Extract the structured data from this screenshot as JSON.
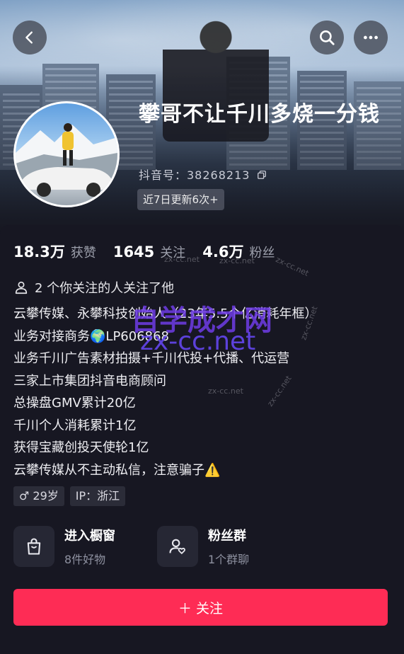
{
  "header": {
    "back_icon": "chevron-left-icon",
    "search_icon": "search-icon",
    "more_icon": "more-horizontal-icon"
  },
  "profile": {
    "name": "攀哥不让千川多烧一分钱",
    "douyin_id": "抖音号：38268213",
    "copy_icon": "copy-icon",
    "update_chip": "近7日更新6次+"
  },
  "stats": [
    {
      "value": "18.3万",
      "label": "获赞"
    },
    {
      "value": "1645",
      "label": "关注"
    },
    {
      "value": "4.6万",
      "label": "粉丝"
    }
  ],
  "mutual": "2 个你关注的人关注了他",
  "bio": [
    "云攀传媒、永攀科技创始人（23年5.5个亿消耗年框）",
    "业务对接商务🌍LP606868",
    "业务千川广告素材拍摄+千川代投+代播、代运营",
    "三家上市集团抖音电商顾问",
    "总操盘GMV累计20亿",
    "千川个人消耗累计1亿",
    "获得宝藏创投天使轮1亿",
    "云攀传媒从不主动私信，注意骗子⚠️"
  ],
  "tags": {
    "gender_age": "♂ 29岁",
    "ip": "IP：浙江"
  },
  "entries": [
    {
      "title": "进入橱窗",
      "subtitle": "8件好物",
      "icon": "shopping-bag-icon"
    },
    {
      "title": "粉丝群",
      "subtitle": "1个群聊",
      "icon": "fan-group-icon"
    }
  ],
  "follow_button": "＋ 关注",
  "watermark": {
    "small": "zx-cc.net",
    "big_line1": "自学成才网",
    "big_line2": "zx-cc.net"
  },
  "colors": {
    "accent": "#fe2c55",
    "background": "#171722"
  }
}
